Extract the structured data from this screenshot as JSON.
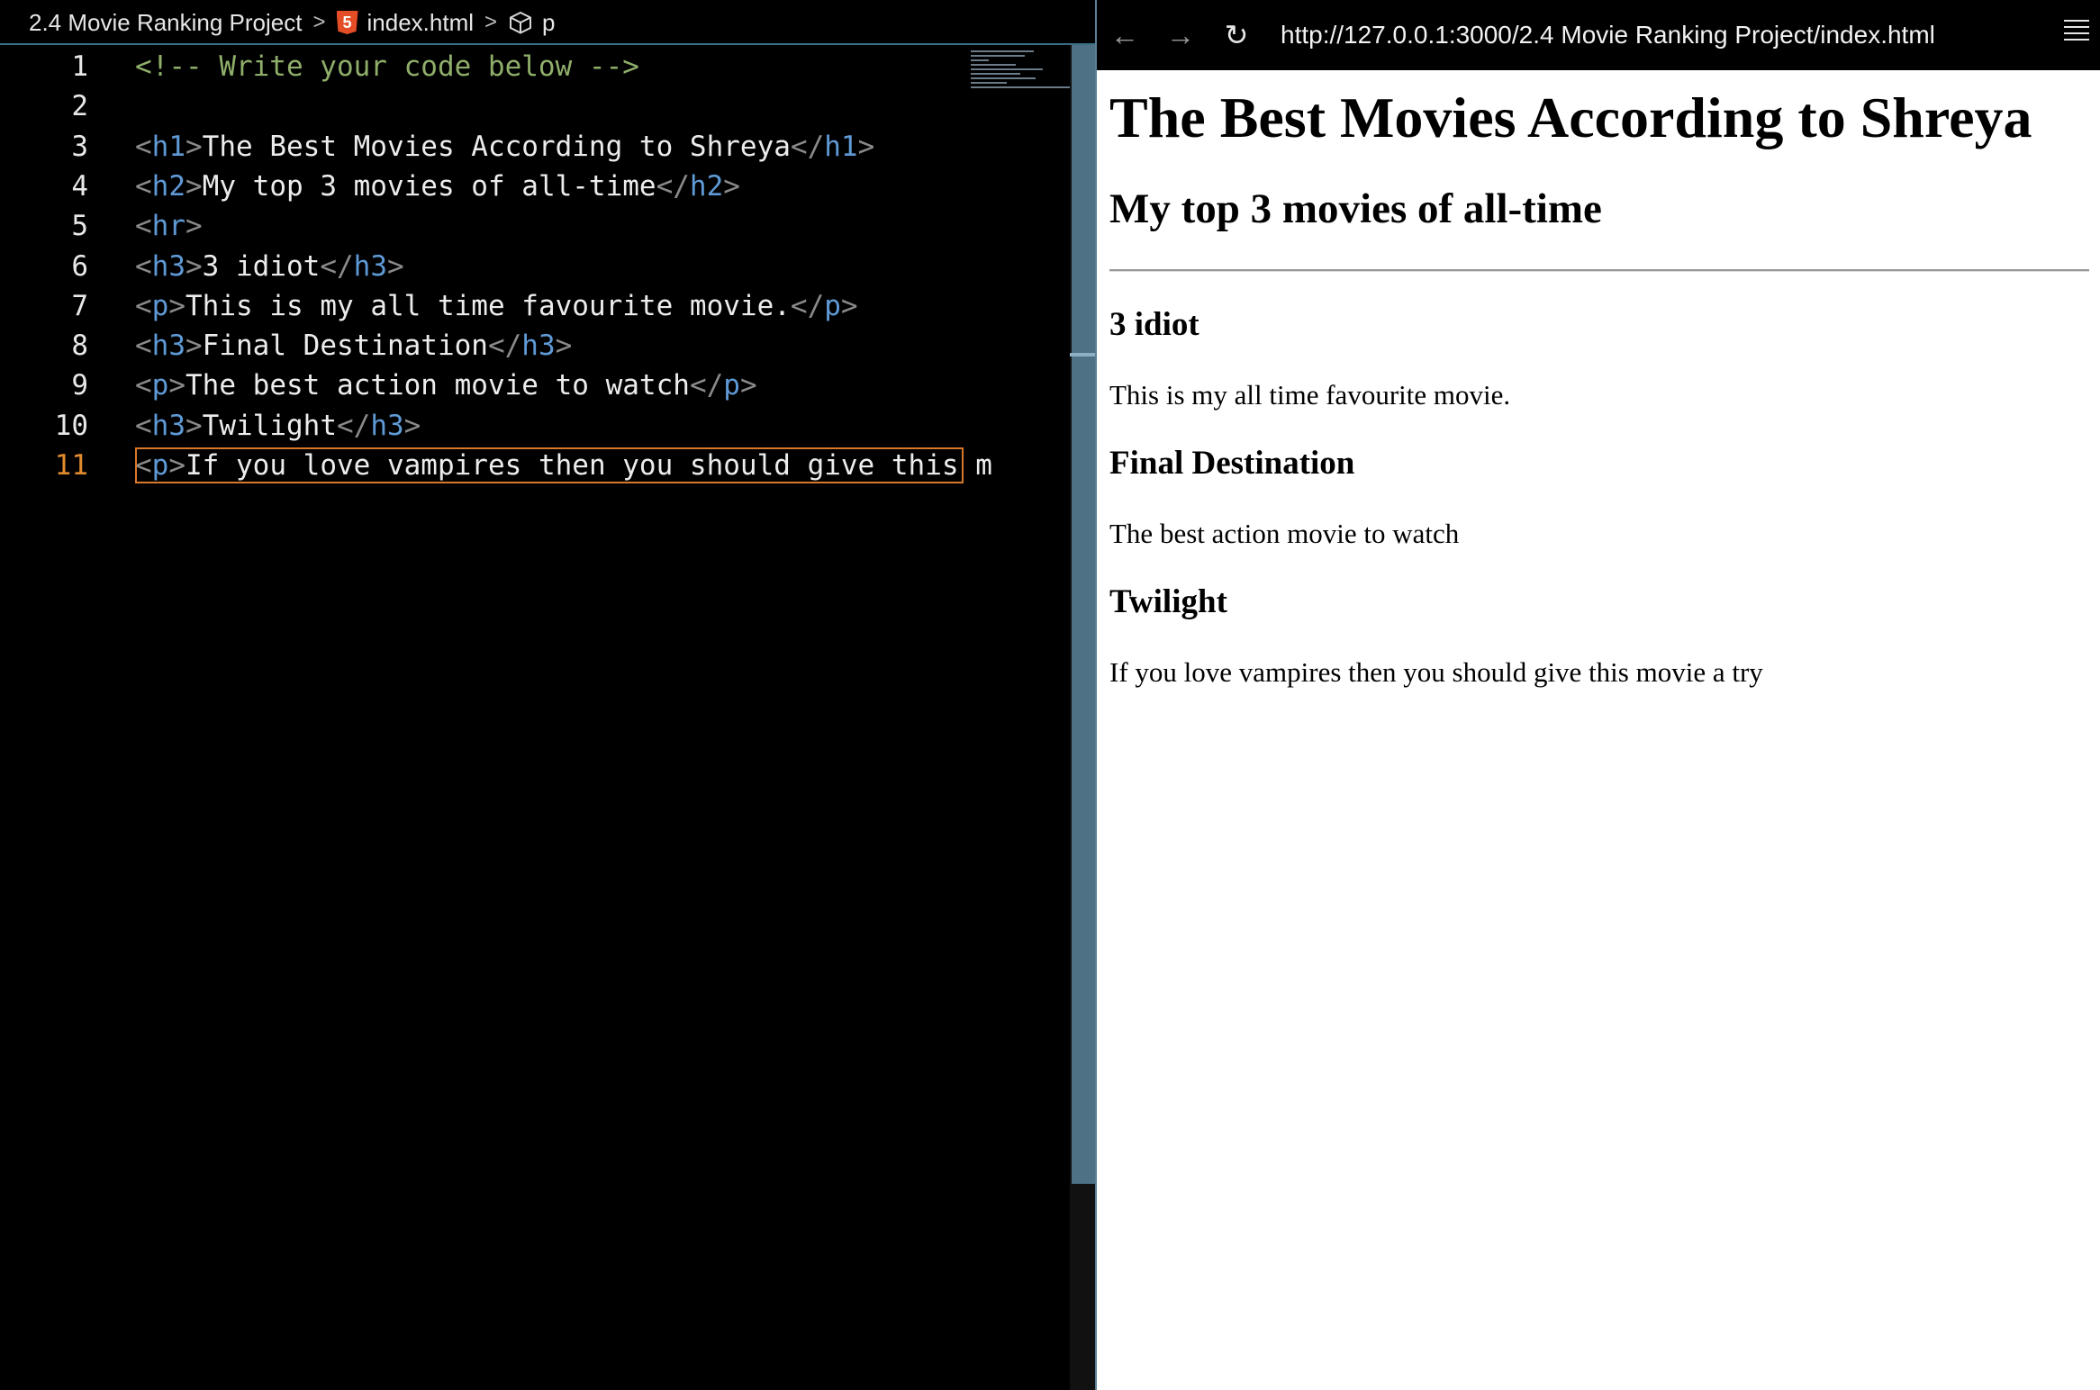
{
  "editor": {
    "breadcrumb": {
      "folder": "2.4 Movie Ranking Project",
      "file": "index.html",
      "element": "p",
      "file_icon": "html5-icon",
      "element_icon": "cube-icon"
    },
    "active_line": 11,
    "lines": [
      {
        "num": "1"
      },
      {
        "num": "2"
      },
      {
        "num": "3",
        "open": "h1",
        "text": "The Best Movies According to Shreya"
      },
      {
        "num": "4",
        "open": "h2",
        "text": "My top 3 movies of all-time"
      },
      {
        "num": "5",
        "open": "hr"
      },
      {
        "num": "6",
        "open": "h3",
        "text": "3 idiot"
      },
      {
        "num": "7",
        "open": "p",
        "text": "This is my all time favourite movie."
      },
      {
        "num": "8",
        "open": "h3",
        "text": "Final Destination"
      },
      {
        "num": "9",
        "open": "p",
        "text": "The best action movie to watch"
      },
      {
        "num": "10",
        "open": "h3",
        "text": "Twilight"
      },
      {
        "num": "11",
        "open": "p",
        "text": "If you love vampires then you should give this m"
      }
    ],
    "comment": "<!-- Write your code below -->",
    "colors": {
      "tag": "#5f9ad6",
      "comment": "#8fae6a",
      "active_line_number": "#e28a2e"
    }
  },
  "browser": {
    "back_icon": "←",
    "forward_icon": "→",
    "reload_icon": "↻",
    "url": "http://127.0.0.1:3000/2.4 Movie Ranking Project/index.html",
    "page": {
      "h1": "The Best Movies According to Shreya",
      "h2": "My top 3 movies of all-time",
      "movies": [
        {
          "title": "3 idiot",
          "desc": "This is my all time favourite movie."
        },
        {
          "title": "Final Destination",
          "desc": "The best action movie to watch"
        },
        {
          "title": "Twilight",
          "desc": "If you love vampires then you should give this movie a try"
        }
      ]
    }
  }
}
